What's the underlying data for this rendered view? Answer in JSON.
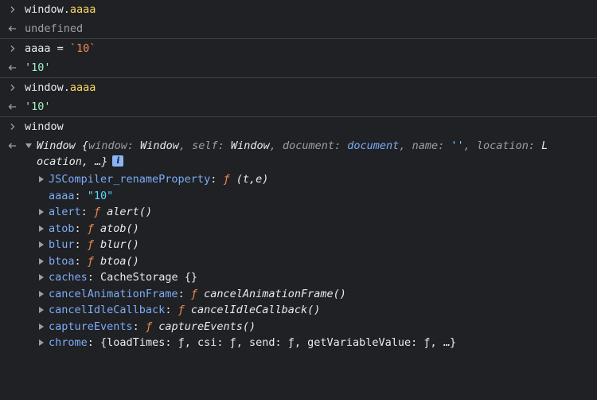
{
  "entries": [
    {
      "input": {
        "prefix": "window.",
        "prop": "aaaa"
      },
      "output": "undefined"
    },
    {
      "input": {
        "prefix": "aaaa = ",
        "value": "`10`"
      },
      "output": "'10'"
    },
    {
      "input": {
        "prefix": "window.",
        "prop": "aaaa"
      },
      "output": "'10'"
    },
    {
      "input": {
        "text": "window"
      }
    }
  ],
  "window_object": {
    "name": "Window",
    "open_brace": "{",
    "summary": [
      {
        "key": "window",
        "value": "Window",
        "style": "type"
      },
      {
        "key": "self",
        "value": "Window",
        "style": "type"
      },
      {
        "key": "document",
        "value": "document",
        "style": "doc"
      },
      {
        "key": "name",
        "value": "''",
        "style": "str"
      },
      {
        "key": "location",
        "value": "L",
        "style": "type"
      }
    ],
    "summary_cont": "ocation, …}",
    "info_icon": "i",
    "properties": [
      {
        "name": "JSCompiler_renameProperty",
        "expandable": true,
        "fn": "ƒ",
        "value": " (t,e)",
        "kind": "function"
      },
      {
        "name": "aaaa",
        "expandable": false,
        "value": "\"10\"",
        "kind": "string"
      },
      {
        "name": "alert",
        "expandable": true,
        "fn": "ƒ",
        "value": " alert()",
        "kind": "function"
      },
      {
        "name": "atob",
        "expandable": true,
        "fn": "ƒ",
        "value": " atob()",
        "kind": "function"
      },
      {
        "name": "blur",
        "expandable": true,
        "fn": "ƒ",
        "value": " blur()",
        "kind": "function"
      },
      {
        "name": "btoa",
        "expandable": true,
        "fn": "ƒ",
        "value": " btoa()",
        "kind": "function"
      },
      {
        "name": "caches",
        "expandable": true,
        "value": "CacheStorage {}",
        "kind": "object"
      },
      {
        "name": "cancelAnimationFrame",
        "expandable": true,
        "fn": "ƒ",
        "value": " cancelAnimationFrame()",
        "kind": "function"
      },
      {
        "name": "cancelIdleCallback",
        "expandable": true,
        "fn": "ƒ",
        "value": " cancelIdleCallback()",
        "kind": "function"
      },
      {
        "name": "captureEvents",
        "expandable": true,
        "fn": "ƒ",
        "value": " captureEvents()",
        "kind": "function"
      },
      {
        "name": "chrome",
        "expandable": true,
        "value": "{loadTimes: ƒ, csi: ƒ, send: ƒ, getVariableValue: ƒ, …}",
        "kind": "object"
      }
    ]
  },
  "colors": {
    "background": "#202124",
    "separator": "#3c4043",
    "key": "#7cacf8",
    "function_f": "#f28b54",
    "string_cyan": "#5cd5fb",
    "string_green": "#9ef0c2",
    "property_yellow": "#fdd663",
    "muted": "#9aa0a6"
  },
  "icons": {
    "input_prompt": "chevron-right-icon",
    "output_return": "return-arrow-icon",
    "expand": "triangle-right-icon",
    "collapse": "triangle-down-icon",
    "info": "info-icon"
  }
}
